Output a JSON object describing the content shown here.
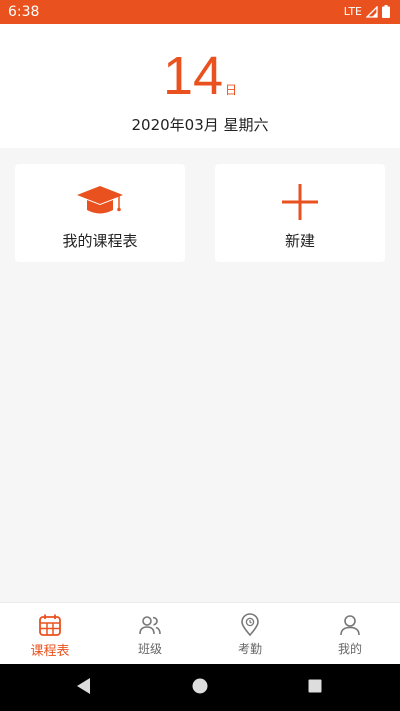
{
  "status_bar": {
    "time": "6:38",
    "network": "LTE",
    "background_color": "#e9521f",
    "icons": [
      "signal-icon",
      "battery-icon"
    ]
  },
  "date_panel": {
    "day": "14",
    "day_suffix": "日",
    "date_text": "2020年03月 星期六",
    "accent_color": "#e9521f"
  },
  "cards": {
    "my_schedule": {
      "label": "我的课程表",
      "icon": "graduation-cap-icon"
    },
    "new": {
      "label": "新建",
      "icon": "plus-icon"
    }
  },
  "bottom_nav": {
    "active": "schedule",
    "items": [
      {
        "key": "schedule",
        "label": "课程表",
        "icon": "calendar-icon"
      },
      {
        "key": "class",
        "label": "班级",
        "icon": "people-icon"
      },
      {
        "key": "attendance",
        "label": "考勤",
        "icon": "location-pin-icon"
      },
      {
        "key": "mine",
        "label": "我的",
        "icon": "person-icon"
      }
    ]
  },
  "system_nav": {
    "buttons": [
      "back-icon",
      "home-icon",
      "recents-icon"
    ]
  }
}
